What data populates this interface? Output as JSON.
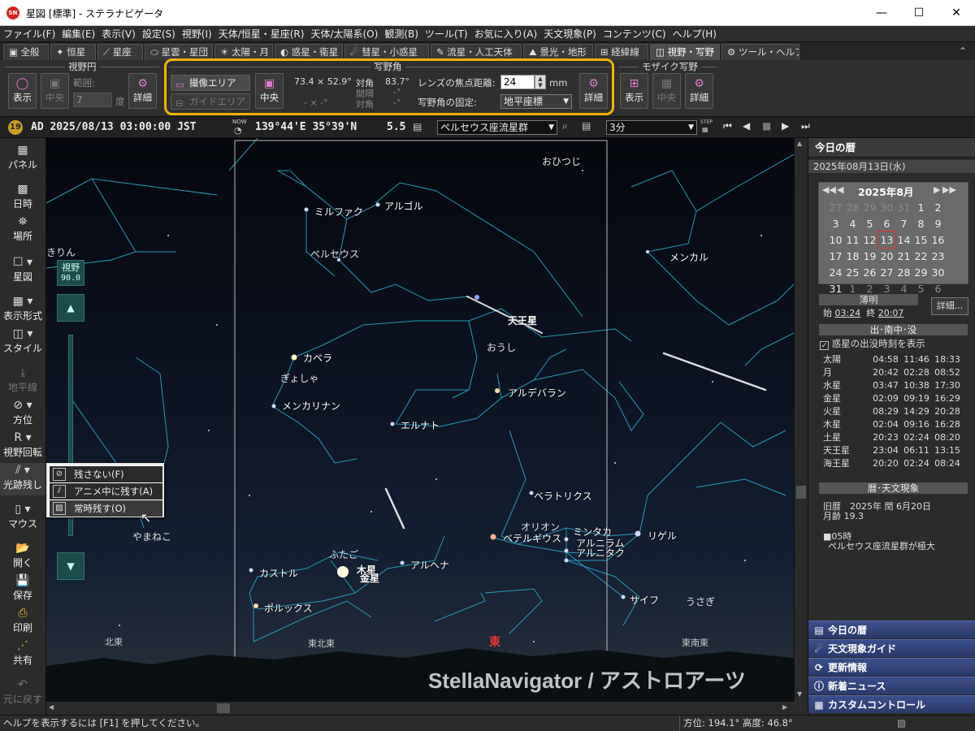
{
  "window": {
    "title": "星図 [標準] - ステラナビゲータ",
    "minimize": "—",
    "maximize": "☐",
    "close": "✕"
  },
  "menu": [
    "ファイル(F)",
    "編集(E)",
    "表示(V)",
    "設定(S)",
    "視野(I)",
    "天体/恒星・星座(R)",
    "天体/太陽系(O)",
    "観測(B)",
    "ツール(T)",
    "お気に入り(A)",
    "天文現象(P)",
    "コンテンツ(C)",
    "ヘルプ(H)"
  ],
  "tabs": [
    "全般",
    "恒星",
    "星座",
    "星雲・星団",
    "太陽・月",
    "惑星・衛星",
    "彗星・小惑星",
    "流星・人工天体",
    "景光・地形",
    "経緯線",
    "視野・写野",
    "ツール・ヘルプ"
  ],
  "ribbon": {
    "fov_circle": {
      "title": "視野円",
      "show": "表示",
      "center": "中央",
      "range_label": "範囲:",
      "range_value": "7",
      "unit": "度",
      "detail": "詳細"
    },
    "photo_field": {
      "title": "写野角",
      "sensor_area": "撮像エリア",
      "guide_area": "ガイドエリア",
      "center": "中央",
      "size": "73.4 × 52.9°",
      "diagonal": "対角",
      "diagonal_value": "83.7°",
      "interval": "間隔",
      "interval_value": "-°",
      "size2": "- ×  -°",
      "diagonal2": "対角",
      "diagonal2_value": "-°",
      "focal_label": "レンズの焦点距離:",
      "focal_value": "24",
      "focal_unit": "mm",
      "fix_label": "写野角の固定:",
      "fix_value": "地平座標",
      "detail": "詳細"
    },
    "mosaic": {
      "title": "モザイク写野",
      "show": "表示",
      "center": "中央",
      "detail": "詳細"
    }
  },
  "infobar": {
    "badge": "19",
    "datetime": "AD 2025/08/13 03:00:00 JST",
    "now": "NOW",
    "location": "139°44'E 35°39'N",
    "magnitude": "5.5",
    "object": "ペルセウス座流星群",
    "step": "3分",
    "step_label": "STEP"
  },
  "sidebar": [
    {
      "label": "パネル",
      "icon": "panel-icon"
    },
    {
      "label": "日時",
      "icon": "calendar-icon"
    },
    {
      "label": "場所",
      "icon": "location-icon"
    },
    {
      "label": "星図",
      "icon": "chart-icon"
    },
    {
      "label": "表示形式",
      "icon": "grid-icon"
    },
    {
      "label": "スタイル",
      "icon": "style-icon"
    },
    {
      "label": "地平線",
      "icon": "horizon-icon"
    },
    {
      "label": "方位",
      "icon": "compass-icon"
    },
    {
      "label": "視野回転",
      "icon": "rotate-icon"
    },
    {
      "label": "光跡残し",
      "icon": "trail-icon"
    },
    {
      "label": "マウス",
      "icon": "mouse-icon"
    },
    {
      "label": "開く",
      "icon": "open-icon"
    },
    {
      "label": "保存",
      "icon": "save-icon"
    },
    {
      "label": "印刷",
      "icon": "print-icon"
    },
    {
      "label": "共有",
      "icon": "share-icon"
    },
    {
      "label": "元に戻す",
      "icon": "undo-icon"
    }
  ],
  "trail_menu": [
    {
      "label": "残さない(F)",
      "icon": "no-trail-icon"
    },
    {
      "label": "アニメ中に残す(A)",
      "icon": "anim-trail-icon"
    },
    {
      "label": "常時残す(O)",
      "icon": "always-trail-icon"
    }
  ],
  "fov_slider": {
    "label": "視野",
    "value": "90.0"
  },
  "sky": {
    "stars": [
      "ミルファク",
      "アルゴル",
      "ペルセウス",
      "カペラ",
      "ぎょしゃ",
      "メンカリナン",
      "エルナト",
      "アルデバラン",
      "おうし",
      "ベテルギウス",
      "オリオン",
      "ミンタカ",
      "アルニラム",
      "アルニタク",
      "リゲル",
      "サイフ",
      "ベラトリクス",
      "カストル",
      "ポルックス",
      "ふたご",
      "アルヘナ",
      "メンカル",
      "おひつじ",
      "きりん",
      "やまねこ",
      "うさぎ"
    ],
    "planets": [
      "天王星",
      "木星",
      "金星"
    ],
    "directions": [
      "北東",
      "東北東",
      "東",
      "東南東"
    ],
    "watermark": "StellaNavigator / アストロアーツ"
  },
  "right_panel": {
    "header": "今日の暦",
    "date": "2025年08月13日(水)",
    "month_label": "2025年8月",
    "weekdays": [],
    "calendar": [
      [
        {
          "d": "27",
          "o": true
        },
        {
          "d": "28",
          "o": true
        },
        {
          "d": "29",
          "o": true
        },
        {
          "d": "30",
          "o": true
        },
        {
          "d": "31",
          "o": true
        },
        {
          "d": "1"
        },
        {
          "d": "2"
        }
      ],
      [
        {
          "d": "3"
        },
        {
          "d": "4"
        },
        {
          "d": "5"
        },
        {
          "d": "6"
        },
        {
          "d": "7"
        },
        {
          "d": "8"
        },
        {
          "d": "9"
        }
      ],
      [
        {
          "d": "10"
        },
        {
          "d": "11"
        },
        {
          "d": "12"
        },
        {
          "d": "13",
          "t": true
        },
        {
          "d": "14"
        },
        {
          "d": "15"
        },
        {
          "d": "16"
        }
      ],
      [
        {
          "d": "17"
        },
        {
          "d": "18"
        },
        {
          "d": "19"
        },
        {
          "d": "20"
        },
        {
          "d": "21"
        },
        {
          "d": "22"
        },
        {
          "d": "23"
        }
      ],
      [
        {
          "d": "24"
        },
        {
          "d": "25"
        },
        {
          "d": "26"
        },
        {
          "d": "27"
        },
        {
          "d": "28"
        },
        {
          "d": "29"
        },
        {
          "d": "30"
        }
      ],
      [
        {
          "d": "31"
        },
        {
          "d": "1",
          "o": true
        },
        {
          "d": "2",
          "o": true
        },
        {
          "d": "3",
          "o": true
        },
        {
          "d": "4",
          "o": true
        },
        {
          "d": "5",
          "o": true
        },
        {
          "d": "6",
          "o": true
        }
      ]
    ],
    "twilight": {
      "title": "薄明",
      "start_label": "始",
      "start": "03:24",
      "end_label": "終",
      "end": "20:07",
      "detail": "詳細..."
    },
    "rise_set": {
      "title": "出･南中･没",
      "checkbox": "惑星の出没時刻を表示",
      "rows": [
        [
          "太陽",
          "04:58",
          "11:46",
          "18:33"
        ],
        [
          "月",
          "20:42",
          "02:28",
          "08:52"
        ],
        [
          "水星",
          "03:47",
          "10:38",
          "17:30"
        ],
        [
          "金星",
          "02:09",
          "09:19",
          "16:29"
        ],
        [
          "火星",
          "08:29",
          "14:29",
          "20:28"
        ],
        [
          "木星",
          "02:04",
          "09:16",
          "16:28"
        ],
        [
          "土星",
          "20:23",
          "02:24",
          "08:20"
        ],
        [
          "天王星",
          "23:04",
          "06:11",
          "13:15"
        ],
        [
          "海王星",
          "20:20",
          "02:24",
          "08:24"
        ]
      ]
    },
    "events": {
      "title": "暦･天文現象",
      "lunar": "旧暦　2025年 閏 6月20日",
      "moon_age": "月齢 19.3",
      "item_time": "■05時",
      "item_text": "ペルセウス座流星群が極大"
    },
    "nav": [
      {
        "label": "今日の暦",
        "icon": "calendar-book-icon"
      },
      {
        "label": "天文現象ガイド",
        "icon": "guide-icon"
      },
      {
        "label": "更新情報",
        "icon": "update-icon"
      },
      {
        "label": "新着ニュース",
        "icon": "news-icon"
      },
      {
        "label": "カスタムコントロール",
        "icon": "custom-icon"
      }
    ]
  },
  "status": {
    "help": "ヘルプを表示するには [F1] を押してください。",
    "coords": "方位: 194.1°  高度: 46.8°"
  }
}
